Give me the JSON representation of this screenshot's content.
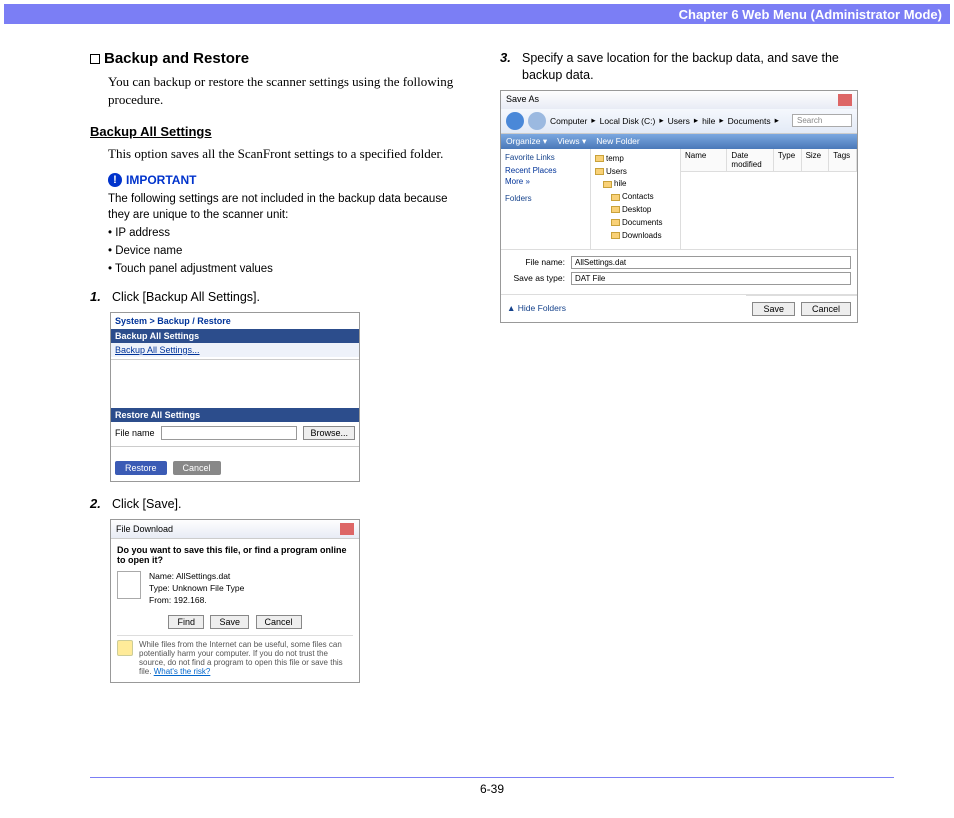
{
  "header": {
    "chapter": "Chapter 6   Web Menu (Administrator Mode)"
  },
  "left": {
    "section_title": "Backup and Restore",
    "intro": "You can backup or restore the scanner settings using the following procedure.",
    "sub_title": "Backup All Settings",
    "sub_text": "This option saves all the ScanFront settings to a specified folder.",
    "important": {
      "label": "IMPORTANT",
      "text": "The following settings are not included in the backup data because they are unique to the scanner unit:",
      "bullets": [
        "IP address",
        "Device name",
        "Touch panel adjustment values"
      ]
    },
    "step1": {
      "num": "1.",
      "text": "Click [Backup All Settings]."
    },
    "ss1": {
      "breadcrumb": "System > Backup / Restore",
      "bar1": "Backup All Settings",
      "link": "Backup All Settings...",
      "bar2": "Restore All Settings",
      "filename_label": "File name",
      "browse": "Browse...",
      "restore": "Restore",
      "cancel": "Cancel"
    },
    "step2": {
      "num": "2.",
      "text": "Click [Save]."
    },
    "ss2": {
      "title": "File Download",
      "question": "Do you want to save this file, or find a program online to open it?",
      "name_label": "Name:",
      "name_value": "AllSettings.dat",
      "type_label": "Type:",
      "type_value": "Unknown File Type",
      "from_label": "From:",
      "from_value": "192.168.",
      "find": "Find",
      "save": "Save",
      "cancel": "Cancel",
      "warning": "While files from the Internet can be useful, some files can potentially harm your computer. If you do not trust the source, do not find a program to open this file or save this file.",
      "risk_link": "What's the risk?"
    }
  },
  "right": {
    "step3": {
      "num": "3.",
      "text": "Specify a save location for the backup data, and save the backup data."
    },
    "ss3": {
      "title": "Save As",
      "path_parts": [
        "Computer",
        "Local Disk (C:)",
        "Users",
        "hile",
        "Documents"
      ],
      "search": "Search",
      "toolbar": [
        "Organize ▾",
        "Views ▾",
        "New Folder"
      ],
      "side_title": "Favorite Links",
      "side_items": [
        "Recent Places",
        "More »"
      ],
      "folders_label": "Folders",
      "tree": [
        {
          "name": "temp",
          "level": 0
        },
        {
          "name": "Users",
          "level": 0
        },
        {
          "name": "hile",
          "level": 1
        },
        {
          "name": "Contacts",
          "level": 2
        },
        {
          "name": "Desktop",
          "level": 2
        },
        {
          "name": "Documents",
          "level": 2
        },
        {
          "name": "Downloads",
          "level": 2
        }
      ],
      "list_headers": [
        "Name",
        "Date modified",
        "Type",
        "Size",
        "Tags"
      ],
      "filename_label": "File name:",
      "filename_value": "AllSettings.dat",
      "savetype_label": "Save as type:",
      "savetype_value": "DAT File",
      "hide_folders": "Hide Folders",
      "save": "Save",
      "cancel": "Cancel"
    }
  },
  "footer": {
    "page": "6-39"
  }
}
